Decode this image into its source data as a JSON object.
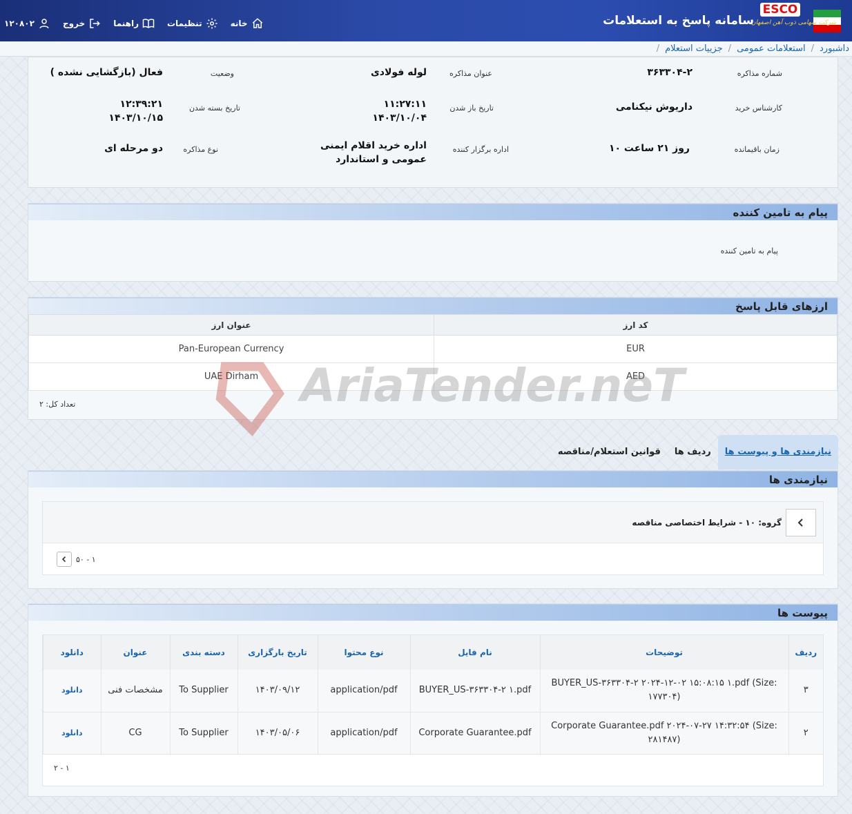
{
  "header": {
    "title": "سامانه پاسخ به استعلامات",
    "logo_text": "ESCO",
    "logo_sub": "شرکت سهامی ذوب آهن اصفهان",
    "nav": {
      "home": "خانه",
      "settings": "تنظیمات",
      "guide": "راهنما",
      "logout": "خروج",
      "user": "۱۲۰۸۰۲"
    },
    "colors": {
      "primary": "#2b4aa8",
      "accent": "#1a65b0"
    }
  },
  "breadcrumb": {
    "items": [
      "داشبورد",
      "استعلامات عمومی",
      "جزییات استعلام"
    ]
  },
  "details": {
    "labels": {
      "number": "شماره مذاکره",
      "subject": "عنوان مذاکره",
      "status": "وضعیت",
      "buyer": "کارشناس خرید",
      "open_date": "تاریخ باز شدن",
      "close_date": "تاریخ بسته شدن",
      "remaining": "زمان باقیمانده",
      "organizer": "اداره برگزار کننده",
      "type": "نوع مذاکره"
    },
    "values": {
      "number": "۳۶۳۳۰۴-۲",
      "subject": "لوله فولادی",
      "status": "فعال (بازگشایی نشده )",
      "buyer": "داریوش نیکنامی",
      "open_time": "۱۱:۲۷:۱۱",
      "open_date": "۱۴۰۳/۱۰/۰۴",
      "close_time": "۱۲:۳۹:۲۱",
      "close_date": "۱۴۰۳/۱۰/۱۵",
      "remaining": "۱۰ روز ۲۱ ساعت",
      "organizer_1": "اداره خرید اقلام ایمنی",
      "organizer_2": "عمومی و استاندارد",
      "type": "دو مرحله ای"
    }
  },
  "supplier_msg": {
    "title": "پیام به تامین کننده",
    "text": "پیام به تامین کننده"
  },
  "currencies": {
    "title": "ارزهای قابل پاسخ",
    "headers": {
      "code": "کد ارز",
      "name": "عنوان ارز"
    },
    "rows": [
      {
        "code": "EUR",
        "name": "Pan-European Currency"
      },
      {
        "code": "AED",
        "name": "UAE Dirham"
      }
    ],
    "total": "تعداد کل: ۲"
  },
  "watermark": "AriaTender.neT",
  "tabs": {
    "active": "نیازمندی ها و پیوست ها",
    "t2": "ردیف ها",
    "t3": "قوانین استعلام/مناقصه"
  },
  "requirements": {
    "title": "نیازمندی ها",
    "group": "گروه: ۱۰ - شرایط اختصاصی مناقصه",
    "pager": "۱ - ۵۰"
  },
  "attachments": {
    "title": "پیوست ها",
    "headers": {
      "row": "ردیف",
      "desc": "توضیحات",
      "file": "نام فایل",
      "mime": "نوع محتوا",
      "date": "تاریخ بارگزاری",
      "cat": "دسته بندی",
      "name": "عنوان",
      "dl": "دانلود"
    },
    "rows": [
      {
        "row": "۳",
        "desc": "BUYER_US-۳۶۳۳۰۴-۲ ۲۰۲۴-۱۲-۰۲ ۱۵:۰۸:۱۵ ۱.pdf (Size: ۱۷۷۳۰۴)",
        "file": "BUYER_US-۳۶۳۳۰۴-۲ ۱.pdf",
        "mime": "application/pdf",
        "date": "۱۴۰۳/۰۹/۱۲",
        "cat": "To Supplier",
        "name": "مشخصات فنی",
        "dl": "دانلود"
      },
      {
        "row": "۲",
        "desc": "Corporate Guarantee.pdf ۲۰۲۴-۰۷-۲۷ ۱۴:۳۲:۵۴ (Size: ۲۸۱۴۸۷)",
        "file": "Corporate Guarantee.pdf",
        "mime": "application/pdf",
        "date": "۱۴۰۳/۰۵/۰۶",
        "cat": "To Supplier",
        "name": "CG",
        "dl": "دانلود"
      }
    ],
    "pager": "۱ - ۲"
  }
}
